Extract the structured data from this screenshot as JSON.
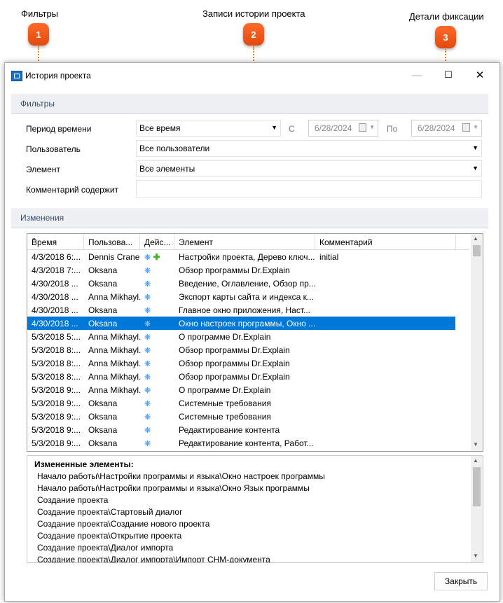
{
  "annotations": [
    {
      "label": "Фильтры",
      "badge": "1"
    },
    {
      "label": "Записи истории проекта",
      "badge": "2"
    },
    {
      "label": "Детали фиксации",
      "badge": "3"
    }
  ],
  "window": {
    "title": "История проекта",
    "controls": {
      "minimize": "—",
      "maximize": "☐",
      "close": "✕"
    }
  },
  "filters": {
    "section_title": "Фильтры",
    "period_label": "Период времени",
    "period_value": "Все время",
    "from_label": "С",
    "from_date": "6/28/2024",
    "to_label": "По",
    "to_date": "6/28/2024",
    "user_label": "Пользователь",
    "user_value": "Все пользователи",
    "element_label": "Элемент",
    "element_value": "Все элементы",
    "comment_label": "Комментарий содержит",
    "comment_value": ""
  },
  "changes": {
    "section_title": "Изменения",
    "columns": [
      "Время",
      "Пользова...",
      "Дейс...",
      "Элемент",
      "Комментарий"
    ],
    "rows": [
      {
        "time": "4/3/2018  6:...",
        "user": "Dennis Crane",
        "actions": [
          "edit",
          "add"
        ],
        "element": "Настройки проекта, Дерево ключ...",
        "comment": "initial"
      },
      {
        "time": "4/3/2018  7:...",
        "user": "Oksana",
        "actions": [
          "edit"
        ],
        "element": "Обзор программы Dr.Explain",
        "comment": ""
      },
      {
        "time": "4/30/2018  ...",
        "user": "Oksana",
        "actions": [
          "edit"
        ],
        "element": "Введение, Оглавление, Обзор пр...",
        "comment": ""
      },
      {
        "time": "4/30/2018  ...",
        "user": "Anna Mikhayl...",
        "actions": [
          "edit"
        ],
        "element": "Экспорт карты сайта и индекса к...",
        "comment": ""
      },
      {
        "time": "4/30/2018  ...",
        "user": "Oksana",
        "actions": [
          "edit"
        ],
        "element": "Главное окно приложения, Наст...",
        "comment": ""
      },
      {
        "time": "4/30/2018  ...",
        "user": "Oksana",
        "actions": [
          "edit"
        ],
        "element": "Окно настроек программы, Окно ...",
        "comment": "",
        "selected": true
      },
      {
        "time": "5/3/2018  5:...",
        "user": "Anna Mikhayl...",
        "actions": [
          "edit"
        ],
        "element": "О программе Dr.Explain",
        "comment": ""
      },
      {
        "time": "5/3/2018  8:...",
        "user": "Anna Mikhayl...",
        "actions": [
          "edit"
        ],
        "element": "Обзор программы Dr.Explain",
        "comment": ""
      },
      {
        "time": "5/3/2018  8:...",
        "user": "Anna Mikhayl...",
        "actions": [
          "edit"
        ],
        "element": "Обзор программы Dr.Explain",
        "comment": ""
      },
      {
        "time": "5/3/2018  8:...",
        "user": "Anna Mikhayl...",
        "actions": [
          "edit"
        ],
        "element": "Обзор программы Dr.Explain",
        "comment": ""
      },
      {
        "time": "5/3/2018  9:...",
        "user": "Anna Mikhayl...",
        "actions": [
          "edit"
        ],
        "element": "О программе Dr.Explain",
        "comment": ""
      },
      {
        "time": "5/3/2018  9:...",
        "user": "Oksana",
        "actions": [
          "edit"
        ],
        "element": "Системные требования",
        "comment": ""
      },
      {
        "time": "5/3/2018  9:...",
        "user": "Oksana",
        "actions": [
          "edit"
        ],
        "element": "Системные требования",
        "comment": ""
      },
      {
        "time": "5/3/2018  9:...",
        "user": "Oksana",
        "actions": [
          "edit"
        ],
        "element": "Редактирование контента",
        "comment": ""
      },
      {
        "time": "5/3/2018  9:...",
        "user": "Oksana",
        "actions": [
          "edit"
        ],
        "element": "Редактирование контента, Работ...",
        "comment": ""
      }
    ]
  },
  "details": {
    "heading": "Измененные элементы:",
    "lines": [
      "Начало работы\\Настройки программы и языка\\Окно настроек программы",
      "Начало работы\\Настройки программы и языка\\Окно Язык программы",
      "Создание проекта",
      "Создание проекта\\Стартовый диалог",
      "Создание проекта\\Создание нового проекта",
      "Создание проекта\\Открытие проекта",
      "Создание проекта\\Диалог импорта",
      "Создание проекта\\Диалог импорта\\Импорт CHM-документа"
    ]
  },
  "footer": {
    "close_label": "Закрыть"
  },
  "icons": {
    "app": "app-icon",
    "edit": "edit-icon",
    "add": "add-icon"
  },
  "colors": {
    "accent": "#0078d7",
    "badge": "#f05a1a",
    "section_bg": "#eef0f3"
  }
}
